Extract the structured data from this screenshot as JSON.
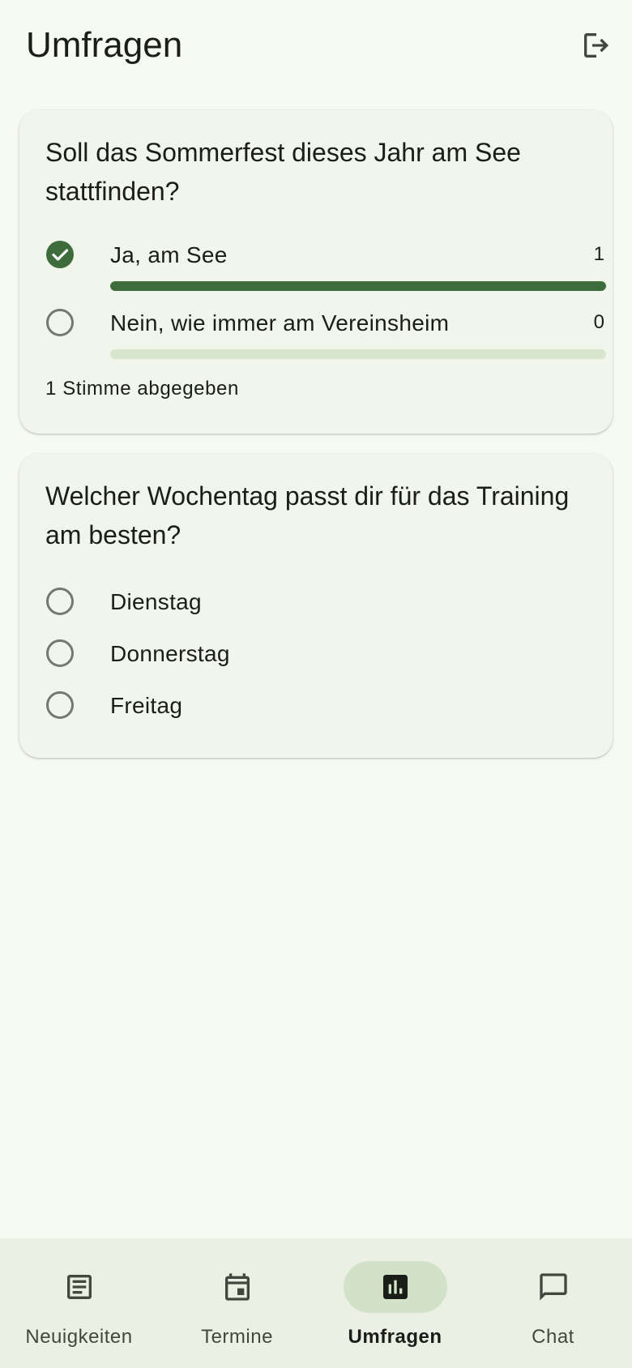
{
  "header": {
    "title": "Umfragen",
    "logout_icon": "logout-icon"
  },
  "polls": [
    {
      "question": "Soll das Sommerfest dieses Jahr am See stattfinden?",
      "options": [
        {
          "label": "Ja, am See",
          "count": "1",
          "selected": true,
          "share": 1.0
        },
        {
          "label": "Nein, wie immer am Vereinsheim",
          "count": "0",
          "selected": false,
          "share": 0.0
        }
      ],
      "summary": "1 Stimme abgegeben"
    },
    {
      "question": "Welcher Wochentag passt dir für das Training am besten?",
      "options": [
        {
          "label": "Dienstag",
          "selected": false
        },
        {
          "label": "Donnerstag",
          "selected": false
        },
        {
          "label": "Freitag",
          "selected": false
        }
      ]
    }
  ],
  "bottom_nav": {
    "items": [
      {
        "label": "Neuigkeiten",
        "icon": "article-icon",
        "active": false
      },
      {
        "label": "Termine",
        "icon": "calendar-icon",
        "active": false
      },
      {
        "label": "Umfragen",
        "icon": "poll-icon",
        "active": true
      },
      {
        "label": "Chat",
        "icon": "chat-icon",
        "active": false
      }
    ]
  },
  "colors": {
    "background": "#f7faf1",
    "card": "#f2f5ec",
    "primary": "#3f6c3c",
    "track": "#d8e6cd",
    "nav_background": "#ecefe4",
    "nav_active_pill": "#d1e2c8"
  }
}
